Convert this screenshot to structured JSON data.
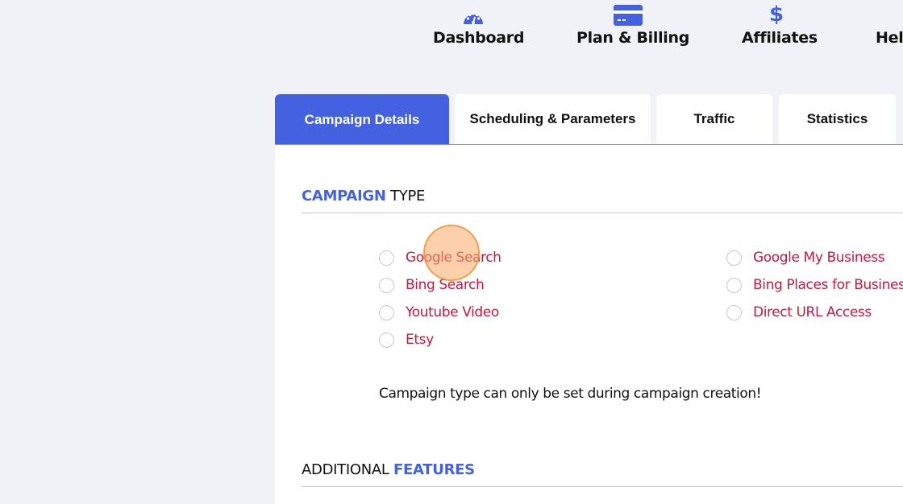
{
  "topnav": {
    "items": [
      {
        "label": "Dashboard",
        "icon": "dashboard-gauge-icon"
      },
      {
        "label": "Plan & Billing",
        "icon": "credit-card-icon"
      },
      {
        "label": "Affiliates",
        "icon": "dollar-icon"
      },
      {
        "label": "Hel",
        "icon": ""
      }
    ]
  },
  "tabs": [
    {
      "label": "Campaign Details",
      "active": true
    },
    {
      "label": "Scheduling & Parameters",
      "active": false
    },
    {
      "label": "Traffic",
      "active": false
    },
    {
      "label": "Statistics",
      "active": false
    }
  ],
  "campaign_type": {
    "title_accent": "CAMPAIGN",
    "title_rest": "TYPE",
    "options_left": [
      {
        "label": "Google Search",
        "checked": false
      },
      {
        "label": "Bing Search",
        "checked": false
      },
      {
        "label": "Youtube Video",
        "checked": false
      },
      {
        "label": "Etsy",
        "checked": false
      }
    ],
    "options_right": [
      {
        "label": "Google My Business",
        "checked": false
      },
      {
        "label": "Bing Places for Busines",
        "checked": false
      },
      {
        "label": "Direct URL Access",
        "checked": false
      }
    ],
    "notice": "Campaign type can only be set during campaign creation!"
  },
  "additional_features": {
    "title_rest": "ADDITIONAL",
    "title_accent": "FEATURES"
  },
  "colors": {
    "accent": "#4361e1",
    "option_text": "#d0163a",
    "background": "#f0f2f7"
  }
}
